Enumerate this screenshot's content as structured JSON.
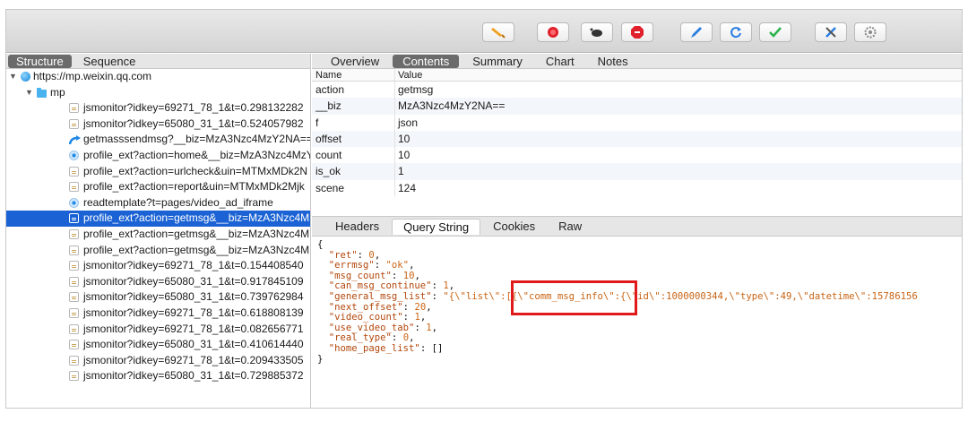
{
  "toolbar": {
    "buttons": [
      {
        "name": "broom-icon",
        "color": "#f0a020"
      },
      {
        "name": "record-icon",
        "color": "#e0202a"
      },
      {
        "name": "turtle-icon",
        "color": "#333333"
      },
      {
        "name": "stop-icon",
        "color": "#e0202a"
      },
      {
        "name": "pen-icon",
        "color": "#2a7de1"
      },
      {
        "name": "refresh-icon",
        "color": "#2a7de1"
      },
      {
        "name": "check-icon",
        "color": "#2bb24c"
      },
      {
        "name": "tools-icon",
        "color": "#2a7de1"
      },
      {
        "name": "settings-icon",
        "color": "#888888"
      }
    ]
  },
  "left": {
    "tabs": [
      "Structure",
      "Sequence"
    ],
    "active_tab": "Structure",
    "host": "https://mp.weixin.qq.com",
    "folder": "mp",
    "items": [
      {
        "icon": "doc",
        "label": "jsmonitor?idkey=69271_78_1&t=0.298132282"
      },
      {
        "icon": "doc",
        "label": "jsmonitor?idkey=65080_31_1&t=0.524057982"
      },
      {
        "icon": "arrow",
        "label": "getmasssendmsg?__biz=MzA3Nzc4MzY2NA=="
      },
      {
        "icon": "dot",
        "label": "profile_ext?action=home&__biz=MzA3Nzc4MzY"
      },
      {
        "icon": "doc",
        "label": "profile_ext?action=urlcheck&uin=MTMxMDk2N"
      },
      {
        "icon": "doc",
        "label": "profile_ext?action=report&uin=MTMxMDk2Mjk"
      },
      {
        "icon": "dot",
        "label": "readtemplate?t=pages/video_ad_iframe"
      },
      {
        "icon": "doc",
        "label": "profile_ext?action=getmsg&__biz=MzA3Nzc4M",
        "selected": true
      },
      {
        "icon": "doc",
        "label": "profile_ext?action=getmsg&__biz=MzA3Nzc4M"
      },
      {
        "icon": "doc",
        "label": "profile_ext?action=getmsg&__biz=MzA3Nzc4M"
      },
      {
        "icon": "doc",
        "label": "jsmonitor?idkey=69271_78_1&t=0.154408540"
      },
      {
        "icon": "doc",
        "label": "jsmonitor?idkey=65080_31_1&t=0.917845109"
      },
      {
        "icon": "doc",
        "label": "jsmonitor?idkey=65080_31_1&t=0.739762984"
      },
      {
        "icon": "doc",
        "label": "jsmonitor?idkey=69271_78_1&t=0.618808139"
      },
      {
        "icon": "doc",
        "label": "jsmonitor?idkey=69271_78_1&t=0.082656771"
      },
      {
        "icon": "doc",
        "label": "jsmonitor?idkey=65080_31_1&t=0.410614440"
      },
      {
        "icon": "doc",
        "label": "jsmonitor?idkey=69271_78_1&t=0.209433505"
      },
      {
        "icon": "doc",
        "label": "jsmonitor?idkey=65080_31_1&t=0.729885372"
      }
    ]
  },
  "right": {
    "tabs": [
      "Overview",
      "Contents",
      "Summary",
      "Chart",
      "Notes"
    ],
    "active_tab": "Contents",
    "table": {
      "headers": [
        "Name",
        "Value"
      ],
      "rows": [
        [
          "action",
          "getmsg"
        ],
        [
          "__biz",
          "MzA3Nzc4MzY2NA=="
        ],
        [
          "f",
          "json"
        ],
        [
          "offset",
          "10"
        ],
        [
          "count",
          "10"
        ],
        [
          "is_ok",
          "1"
        ],
        [
          "scene",
          "124"
        ]
      ]
    },
    "subtabs": [
      "Headers",
      "Query String",
      "Cookies",
      "Raw"
    ],
    "active_subtab": "Query String",
    "json_lines": [
      [
        [
          "{",
          "n"
        ]
      ],
      [
        [
          "  \"ret\"",
          "k"
        ],
        [
          ": ",
          "n"
        ],
        [
          "0",
          "v"
        ],
        [
          ",",
          "n"
        ]
      ],
      [
        [
          "  \"errmsg\"",
          "k"
        ],
        [
          ": ",
          "n"
        ],
        [
          "\"ok\"",
          "v"
        ],
        [
          ",",
          "n"
        ]
      ],
      [
        [
          "  \"msg_count\"",
          "k"
        ],
        [
          ": ",
          "n"
        ],
        [
          "10",
          "v"
        ],
        [
          ",",
          "n"
        ]
      ],
      [
        [
          "  \"can_msg_continue\"",
          "k"
        ],
        [
          ": ",
          "n"
        ],
        [
          "1",
          "v"
        ],
        [
          ",",
          "n"
        ]
      ],
      [
        [
          "  \"general_msg_list\"",
          "k"
        ],
        [
          ": ",
          "n"
        ],
        [
          "\"{\\\"list\\\":[{\\\"comm_msg_info\\\":{\\\"id\\\":1000000344,\\\"type\\\":49,\\\"datetime\\\":15786156",
          "v"
        ]
      ],
      [
        [
          "  \"next_offset\"",
          "k"
        ],
        [
          ": ",
          "n"
        ],
        [
          "20",
          "v"
        ],
        [
          ",",
          "n"
        ]
      ],
      [
        [
          "  \"video_count\"",
          "k"
        ],
        [
          ": ",
          "n"
        ],
        [
          "1",
          "v"
        ],
        [
          ",",
          "n"
        ]
      ],
      [
        [
          "  \"use_video_tab\"",
          "k"
        ],
        [
          ": ",
          "n"
        ],
        [
          "1",
          "v"
        ],
        [
          ",",
          "n"
        ]
      ],
      [
        [
          "  \"real_type\"",
          "k"
        ],
        [
          ": ",
          "n"
        ],
        [
          "0",
          "v"
        ],
        [
          ",",
          "n"
        ]
      ],
      [
        [
          "  \"home_page_list\"",
          "k"
        ],
        [
          ": ",
          "n"
        ],
        [
          "[]",
          "n"
        ]
      ],
      [
        [
          "}",
          "n"
        ]
      ]
    ]
  }
}
